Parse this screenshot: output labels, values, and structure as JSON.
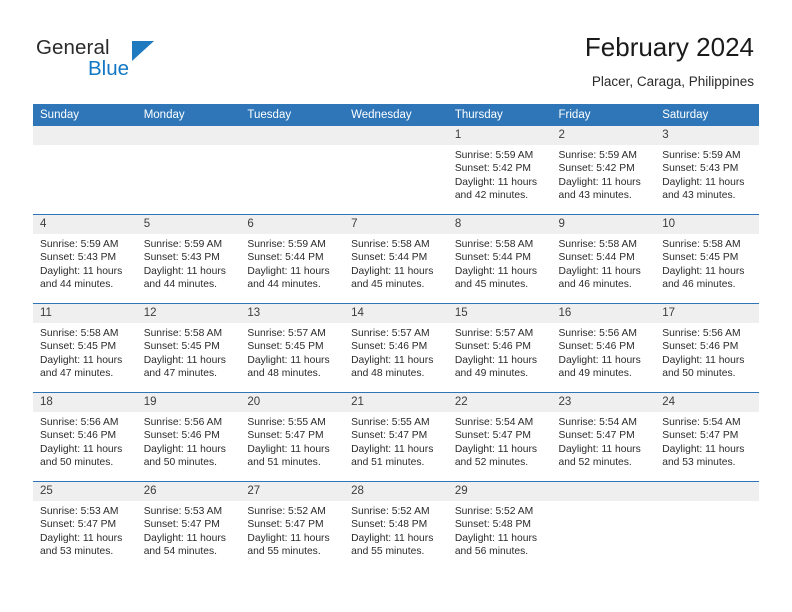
{
  "logo": {
    "word1": "General",
    "word2": "Blue",
    "triangle_color": "#1f7ac0",
    "text_color": "#2b2b2b",
    "blue_text_color": "#1277c4"
  },
  "header": {
    "title": "February 2024",
    "subtitle": "Placer, Caraga, Philippines"
  },
  "theme": {
    "header_bg": "#2e76b8",
    "header_text": "#ffffff",
    "daynum_bg": "#efefef",
    "rule_color": "#2e76b8"
  },
  "weekday_headers": [
    "Sunday",
    "Monday",
    "Tuesday",
    "Wednesday",
    "Thursday",
    "Friday",
    "Saturday"
  ],
  "weeks": [
    [
      {
        "day": "",
        "empty": true,
        "sunrise": "",
        "sunset": "",
        "daylight_line1": "",
        "daylight_line2": ""
      },
      {
        "day": "",
        "empty": true,
        "sunrise": "",
        "sunset": "",
        "daylight_line1": "",
        "daylight_line2": ""
      },
      {
        "day": "",
        "empty": true,
        "sunrise": "",
        "sunset": "",
        "daylight_line1": "",
        "daylight_line2": ""
      },
      {
        "day": "",
        "empty": true,
        "sunrise": "",
        "sunset": "",
        "daylight_line1": "",
        "daylight_line2": ""
      },
      {
        "day": "1",
        "empty": false,
        "sunrise": "Sunrise: 5:59 AM",
        "sunset": "Sunset: 5:42 PM",
        "daylight_line1": "Daylight: 11 hours",
        "daylight_line2": "and 42 minutes."
      },
      {
        "day": "2",
        "empty": false,
        "sunrise": "Sunrise: 5:59 AM",
        "sunset": "Sunset: 5:42 PM",
        "daylight_line1": "Daylight: 11 hours",
        "daylight_line2": "and 43 minutes."
      },
      {
        "day": "3",
        "empty": false,
        "sunrise": "Sunrise: 5:59 AM",
        "sunset": "Sunset: 5:43 PM",
        "daylight_line1": "Daylight: 11 hours",
        "daylight_line2": "and 43 minutes."
      }
    ],
    [
      {
        "day": "4",
        "empty": false,
        "sunrise": "Sunrise: 5:59 AM",
        "sunset": "Sunset: 5:43 PM",
        "daylight_line1": "Daylight: 11 hours",
        "daylight_line2": "and 44 minutes."
      },
      {
        "day": "5",
        "empty": false,
        "sunrise": "Sunrise: 5:59 AM",
        "sunset": "Sunset: 5:43 PM",
        "daylight_line1": "Daylight: 11 hours",
        "daylight_line2": "and 44 minutes."
      },
      {
        "day": "6",
        "empty": false,
        "sunrise": "Sunrise: 5:59 AM",
        "sunset": "Sunset: 5:44 PM",
        "daylight_line1": "Daylight: 11 hours",
        "daylight_line2": "and 44 minutes."
      },
      {
        "day": "7",
        "empty": false,
        "sunrise": "Sunrise: 5:58 AM",
        "sunset": "Sunset: 5:44 PM",
        "daylight_line1": "Daylight: 11 hours",
        "daylight_line2": "and 45 minutes."
      },
      {
        "day": "8",
        "empty": false,
        "sunrise": "Sunrise: 5:58 AM",
        "sunset": "Sunset: 5:44 PM",
        "daylight_line1": "Daylight: 11 hours",
        "daylight_line2": "and 45 minutes."
      },
      {
        "day": "9",
        "empty": false,
        "sunrise": "Sunrise: 5:58 AM",
        "sunset": "Sunset: 5:44 PM",
        "daylight_line1": "Daylight: 11 hours",
        "daylight_line2": "and 46 minutes."
      },
      {
        "day": "10",
        "empty": false,
        "sunrise": "Sunrise: 5:58 AM",
        "sunset": "Sunset: 5:45 PM",
        "daylight_line1": "Daylight: 11 hours",
        "daylight_line2": "and 46 minutes."
      }
    ],
    [
      {
        "day": "11",
        "empty": false,
        "sunrise": "Sunrise: 5:58 AM",
        "sunset": "Sunset: 5:45 PM",
        "daylight_line1": "Daylight: 11 hours",
        "daylight_line2": "and 47 minutes."
      },
      {
        "day": "12",
        "empty": false,
        "sunrise": "Sunrise: 5:58 AM",
        "sunset": "Sunset: 5:45 PM",
        "daylight_line1": "Daylight: 11 hours",
        "daylight_line2": "and 47 minutes."
      },
      {
        "day": "13",
        "empty": false,
        "sunrise": "Sunrise: 5:57 AM",
        "sunset": "Sunset: 5:45 PM",
        "daylight_line1": "Daylight: 11 hours",
        "daylight_line2": "and 48 minutes."
      },
      {
        "day": "14",
        "empty": false,
        "sunrise": "Sunrise: 5:57 AM",
        "sunset": "Sunset: 5:46 PM",
        "daylight_line1": "Daylight: 11 hours",
        "daylight_line2": "and 48 minutes."
      },
      {
        "day": "15",
        "empty": false,
        "sunrise": "Sunrise: 5:57 AM",
        "sunset": "Sunset: 5:46 PM",
        "daylight_line1": "Daylight: 11 hours",
        "daylight_line2": "and 49 minutes."
      },
      {
        "day": "16",
        "empty": false,
        "sunrise": "Sunrise: 5:56 AM",
        "sunset": "Sunset: 5:46 PM",
        "daylight_line1": "Daylight: 11 hours",
        "daylight_line2": "and 49 minutes."
      },
      {
        "day": "17",
        "empty": false,
        "sunrise": "Sunrise: 5:56 AM",
        "sunset": "Sunset: 5:46 PM",
        "daylight_line1": "Daylight: 11 hours",
        "daylight_line2": "and 50 minutes."
      }
    ],
    [
      {
        "day": "18",
        "empty": false,
        "sunrise": "Sunrise: 5:56 AM",
        "sunset": "Sunset: 5:46 PM",
        "daylight_line1": "Daylight: 11 hours",
        "daylight_line2": "and 50 minutes."
      },
      {
        "day": "19",
        "empty": false,
        "sunrise": "Sunrise: 5:56 AM",
        "sunset": "Sunset: 5:46 PM",
        "daylight_line1": "Daylight: 11 hours",
        "daylight_line2": "and 50 minutes."
      },
      {
        "day": "20",
        "empty": false,
        "sunrise": "Sunrise: 5:55 AM",
        "sunset": "Sunset: 5:47 PM",
        "daylight_line1": "Daylight: 11 hours",
        "daylight_line2": "and 51 minutes."
      },
      {
        "day": "21",
        "empty": false,
        "sunrise": "Sunrise: 5:55 AM",
        "sunset": "Sunset: 5:47 PM",
        "daylight_line1": "Daylight: 11 hours",
        "daylight_line2": "and 51 minutes."
      },
      {
        "day": "22",
        "empty": false,
        "sunrise": "Sunrise: 5:54 AM",
        "sunset": "Sunset: 5:47 PM",
        "daylight_line1": "Daylight: 11 hours",
        "daylight_line2": "and 52 minutes."
      },
      {
        "day": "23",
        "empty": false,
        "sunrise": "Sunrise: 5:54 AM",
        "sunset": "Sunset: 5:47 PM",
        "daylight_line1": "Daylight: 11 hours",
        "daylight_line2": "and 52 minutes."
      },
      {
        "day": "24",
        "empty": false,
        "sunrise": "Sunrise: 5:54 AM",
        "sunset": "Sunset: 5:47 PM",
        "daylight_line1": "Daylight: 11 hours",
        "daylight_line2": "and 53 minutes."
      }
    ],
    [
      {
        "day": "25",
        "empty": false,
        "sunrise": "Sunrise: 5:53 AM",
        "sunset": "Sunset: 5:47 PM",
        "daylight_line1": "Daylight: 11 hours",
        "daylight_line2": "and 53 minutes."
      },
      {
        "day": "26",
        "empty": false,
        "sunrise": "Sunrise: 5:53 AM",
        "sunset": "Sunset: 5:47 PM",
        "daylight_line1": "Daylight: 11 hours",
        "daylight_line2": "and 54 minutes."
      },
      {
        "day": "27",
        "empty": false,
        "sunrise": "Sunrise: 5:52 AM",
        "sunset": "Sunset: 5:47 PM",
        "daylight_line1": "Daylight: 11 hours",
        "daylight_line2": "and 55 minutes."
      },
      {
        "day": "28",
        "empty": false,
        "sunrise": "Sunrise: 5:52 AM",
        "sunset": "Sunset: 5:48 PM",
        "daylight_line1": "Daylight: 11 hours",
        "daylight_line2": "and 55 minutes."
      },
      {
        "day": "29",
        "empty": false,
        "sunrise": "Sunrise: 5:52 AM",
        "sunset": "Sunset: 5:48 PM",
        "daylight_line1": "Daylight: 11 hours",
        "daylight_line2": "and 56 minutes."
      },
      {
        "day": "",
        "empty": true,
        "sunrise": "",
        "sunset": "",
        "daylight_line1": "",
        "daylight_line2": ""
      },
      {
        "day": "",
        "empty": true,
        "sunrise": "",
        "sunset": "",
        "daylight_line1": "",
        "daylight_line2": ""
      }
    ]
  ]
}
